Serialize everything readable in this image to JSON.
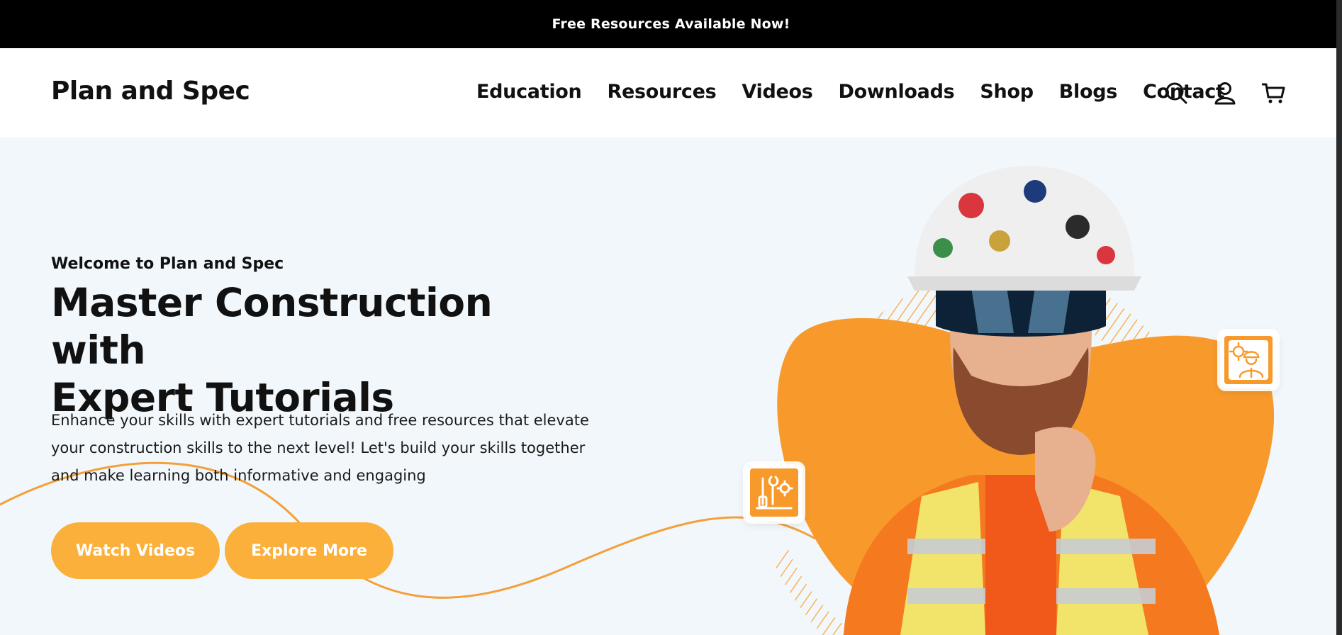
{
  "announcement": "Free Resources Available Now!",
  "header": {
    "logo": "Plan and Spec",
    "nav": [
      "Education",
      "Resources",
      "Videos",
      "Downloads",
      "Shop",
      "Blogs",
      "Contact"
    ],
    "icons": [
      "search-icon",
      "account-icon",
      "cart-icon"
    ]
  },
  "hero": {
    "eyebrow": "Welcome to Plan and Spec",
    "headline_line1": "Master Construction with",
    "headline_line2": "Expert Tutorials",
    "description": "Enhance your skills with expert tutorials and free resources that elevate your construction skills to the next level! Let's build your skills together and make learning both informative and engaging",
    "buttons": [
      "Watch Videos",
      "Explore More"
    ]
  },
  "colors": {
    "accent": "#fbb03b",
    "blob": "#f79a2b",
    "announce_bg": "#000000",
    "hero_bg": "#f2f7fb"
  }
}
